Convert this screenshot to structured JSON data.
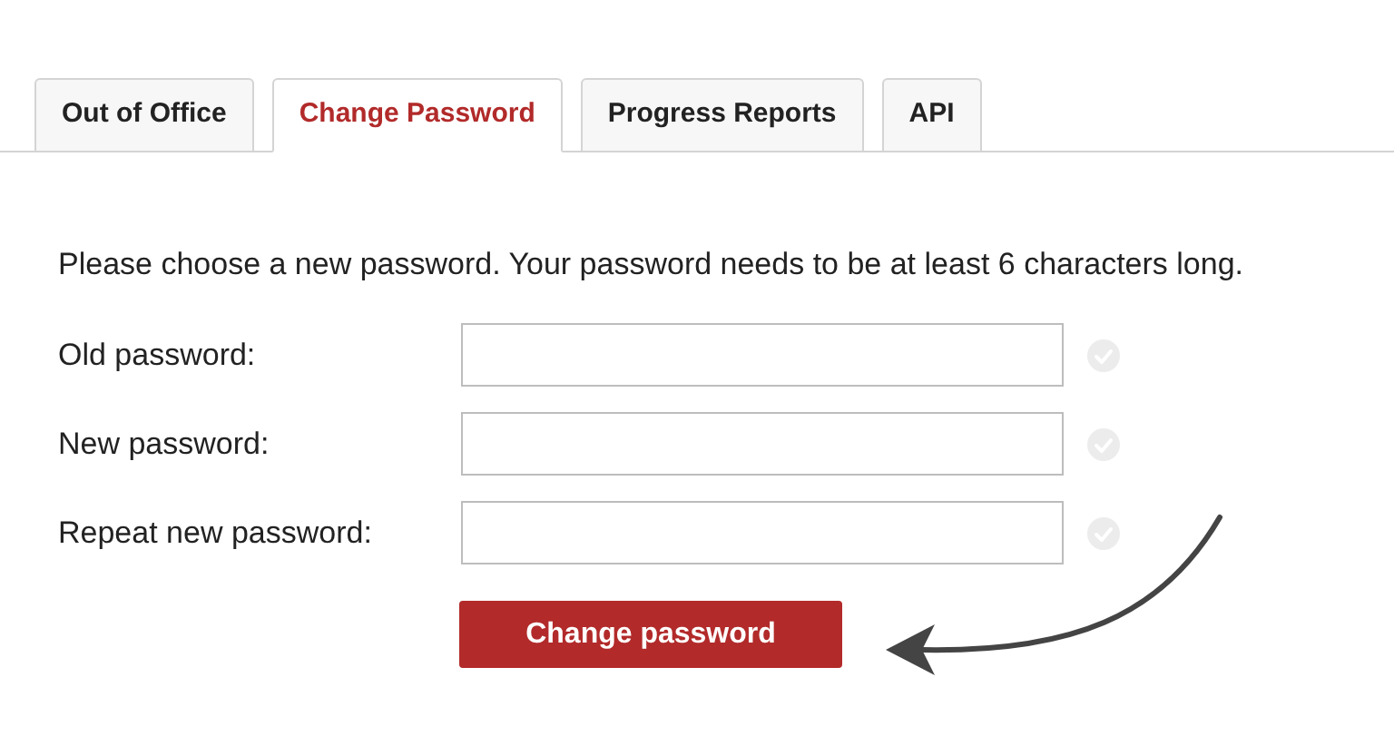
{
  "tabs": [
    {
      "label": "Out of Office",
      "selected": false
    },
    {
      "label": "Change Password",
      "selected": true
    },
    {
      "label": "Progress Reports",
      "selected": false
    },
    {
      "label": "API",
      "selected": false
    }
  ],
  "intro": "Please choose a new password. Your password needs to be at least 6 characters long.",
  "fields": [
    {
      "label": "Old password:",
      "valid": false
    },
    {
      "label": "New password:",
      "valid": false
    },
    {
      "label": "Repeat new password:",
      "valid": false
    }
  ],
  "submit": "Change password"
}
